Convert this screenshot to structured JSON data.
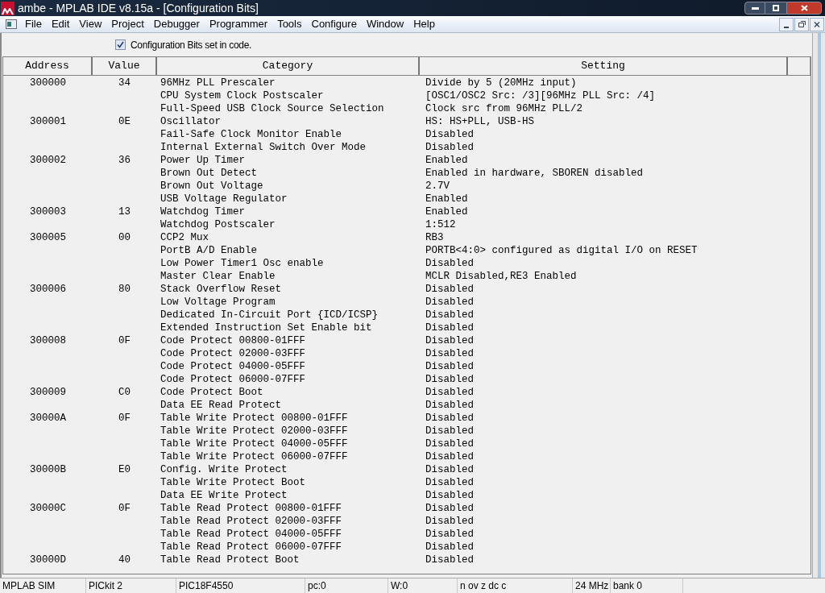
{
  "window": {
    "title": "ambe - MPLAB IDE v8.15a - [Configuration Bits]"
  },
  "menu": [
    "File",
    "Edit",
    "View",
    "Project",
    "Debugger",
    "Programmer",
    "Tools",
    "Configure",
    "Window",
    "Help"
  ],
  "option": {
    "label": "Configuration Bits set in code.",
    "checked": true
  },
  "table": {
    "columns": [
      "Address",
      "Value",
      "Category",
      "Setting"
    ],
    "rows": [
      {
        "address": "300000",
        "value": "34",
        "category": "96MHz PLL Prescaler",
        "setting": "Divide by 5 (20MHz input)"
      },
      {
        "category": "CPU System Clock Postscaler",
        "setting": "[OSC1/OSC2 Src: /3][96MHz PLL Src: /4]"
      },
      {
        "category": "Full-Speed USB Clock Source Selection",
        "setting": "Clock src from 96MHz PLL/2"
      },
      {
        "address": "300001",
        "value": "0E",
        "category": "Oscillator",
        "setting": "HS: HS+PLL, USB-HS"
      },
      {
        "category": "Fail-Safe Clock Monitor Enable",
        "setting": "Disabled"
      },
      {
        "category": "Internal External Switch Over Mode",
        "setting": "Disabled"
      },
      {
        "address": "300002",
        "value": "36",
        "category": "Power Up Timer",
        "setting": "Enabled"
      },
      {
        "category": "Brown Out Detect",
        "setting": "Enabled in hardware, SBOREN disabled"
      },
      {
        "category": "Brown Out Voltage",
        "setting": "2.7V"
      },
      {
        "category": "USB Voltage Regulator",
        "setting": "Enabled"
      },
      {
        "address": "300003",
        "value": "13",
        "category": "Watchdog Timer",
        "setting": "Enabled"
      },
      {
        "category": "Watchdog Postscaler",
        "setting": "1:512"
      },
      {
        "address": "300005",
        "value": "00",
        "category": "CCP2 Mux",
        "setting": "RB3"
      },
      {
        "category": "PortB A/D Enable",
        "setting": "PORTB<4:0> configured as digital I/O on RESET"
      },
      {
        "category": "Low Power Timer1 Osc enable",
        "setting": "Disabled"
      },
      {
        "category": "Master Clear Enable",
        "setting": "MCLR Disabled,RE3 Enabled"
      },
      {
        "address": "300006",
        "value": "80",
        "category": "Stack Overflow Reset",
        "setting": "Disabled"
      },
      {
        "category": "Low Voltage Program",
        "setting": "Disabled"
      },
      {
        "category": "Dedicated In-Circuit Port {ICD/ICSP}",
        "setting": "Disabled"
      },
      {
        "category": "Extended Instruction Set Enable bit",
        "setting": "Disabled"
      },
      {
        "address": "300008",
        "value": "0F",
        "category": "Code Protect 00800-01FFF",
        "setting": "Disabled"
      },
      {
        "category": "Code Protect 02000-03FFF",
        "setting": "Disabled"
      },
      {
        "category": "Code Protect 04000-05FFF",
        "setting": "Disabled"
      },
      {
        "category": "Code Protect 06000-07FFF",
        "setting": "Disabled"
      },
      {
        "address": "300009",
        "value": "C0",
        "category": "Code Protect Boot",
        "setting": "Disabled"
      },
      {
        "category": "Data EE Read Protect",
        "setting": "Disabled"
      },
      {
        "address": "30000A",
        "value": "0F",
        "category": "Table Write Protect 00800-01FFF",
        "setting": "Disabled"
      },
      {
        "category": "Table Write Protect 02000-03FFF",
        "setting": "Disabled"
      },
      {
        "category": "Table Write Protect 04000-05FFF",
        "setting": "Disabled"
      },
      {
        "category": "Table Write Protect 06000-07FFF",
        "setting": "Disabled"
      },
      {
        "address": "30000B",
        "value": "E0",
        "category": "Config. Write Protect",
        "setting": "Disabled"
      },
      {
        "category": "Table Write Protect Boot",
        "setting": "Disabled"
      },
      {
        "category": "Data EE Write Protect",
        "setting": "Disabled"
      },
      {
        "address": "30000C",
        "value": "0F",
        "category": "Table Read Protect 00800-01FFF",
        "setting": "Disabled"
      },
      {
        "category": "Table Read Protect 02000-03FFF",
        "setting": "Disabled"
      },
      {
        "category": "Table Read Protect 04000-05FFF",
        "setting": "Disabled"
      },
      {
        "category": "Table Read Protect 06000-07FFF",
        "setting": "Disabled"
      },
      {
        "address": "30000D",
        "value": "40",
        "category": "Table Read Protect Boot",
        "setting": "Disabled"
      }
    ]
  },
  "status_bar": [
    "MPLAB SIM",
    "PICkit 2",
    "PIC18F4550",
    "pc:0",
    "W:0",
    "n ov z dc c",
    "24 MHz",
    "bank 0"
  ]
}
